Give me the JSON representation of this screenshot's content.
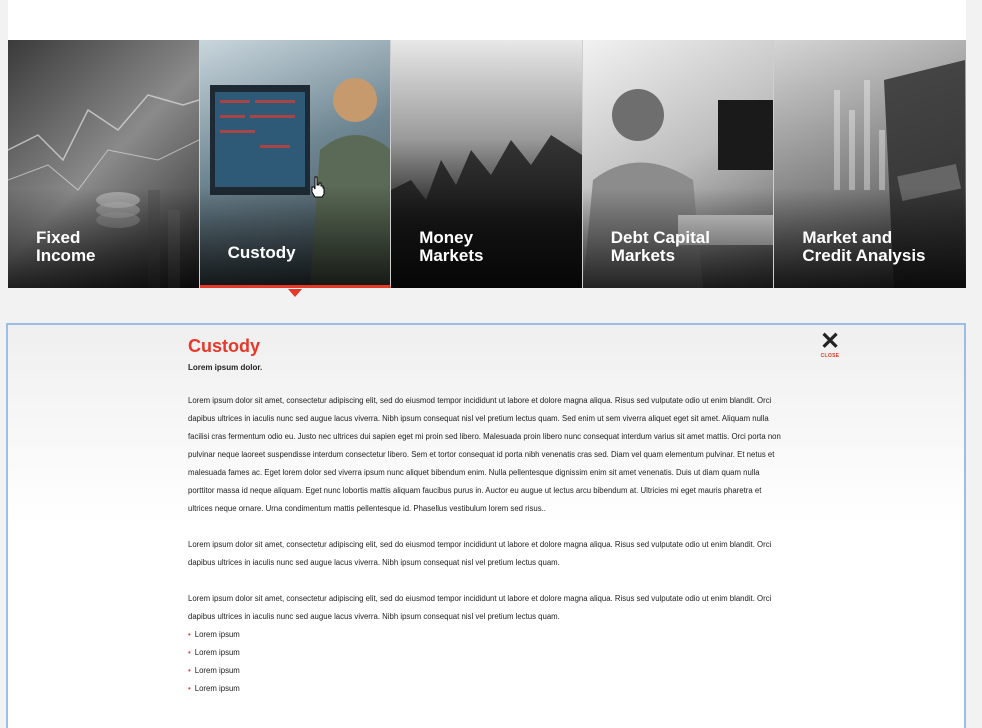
{
  "tiles": [
    {
      "label": "Fixed\nIncome",
      "active": false
    },
    {
      "label": "Custody",
      "active": true
    },
    {
      "label": "Money\nMarkets",
      "active": false
    },
    {
      "label": "Debt Capital\nMarkets",
      "active": false
    },
    {
      "label": "Market and\nCredit Analysis",
      "active": false
    }
  ],
  "panel": {
    "title": "Custody",
    "subtitle": "Lorem ipsum dolor.",
    "close_label": "CLOSE",
    "paragraphs": [
      "Lorem ipsum dolor sit amet, consectetur adipiscing elit, sed do eiusmod tempor incididunt ut labore et dolore magna aliqua. Risus sed vulputate odio ut enim blandit. Orci dapibus ultrices in iaculis nunc sed augue lacus viverra. Nibh ipsum consequat nisl vel pretium lectus quam. Sed enim ut sem viverra aliquet eget sit amet. Aliquam nulla facilisi cras fermentum odio eu. Justo nec ultrices dui sapien eget mi proin sed libero. Malesuada proin libero nunc consequat interdum varius sit amet mattis. Orci porta non pulvinar neque laoreet suspendisse interdum consectetur libero. Sem et tortor consequat id porta nibh venenatis cras sed. Diam vel quam elementum pulvinar. Et netus et malesuada fames ac. Eget lorem dolor sed viverra ipsum nunc aliquet bibendum enim. Nulla pellentesque dignissim enim sit amet venenatis. Duis ut diam quam nulla porttitor massa id neque aliquam. Eget nunc lobortis mattis aliquam faucibus purus in. Auctor eu augue ut lectus arcu bibendum at. Ultricies mi eget mauris pharetra et ultrices neque ornare. Urna condimentum mattis pellentesque id. Phasellus vestibulum lorem sed risus..",
      "Lorem ipsum dolor sit amet, consectetur adipiscing elit, sed do eiusmod tempor incididunt ut labore et dolore magna aliqua. Risus sed vulputate odio ut enim blandit. Orci dapibus ultrices in iaculis nunc sed augue lacus viverra. Nibh ipsum consequat nisl vel pretium lectus quam.",
      "Lorem ipsum dolor sit amet, consectetur adipiscing elit, sed do eiusmod tempor incididunt ut labore et dolore magna aliqua. Risus sed vulputate odio ut enim blandit. Orci dapibus ultrices in iaculis nunc sed augue lacus viverra. Nibh ipsum consequat nisl vel pretium lectus quam."
    ],
    "bullets": [
      "Lorem ipsum",
      "Lorem ipsum",
      "Lorem ipsum",
      "Lorem ipsum"
    ]
  },
  "colors": {
    "accent": "#e6392a",
    "panel_border": "#9cbde6"
  },
  "icons": {
    "close": "close-icon",
    "cursor": "hand-cursor-icon"
  }
}
